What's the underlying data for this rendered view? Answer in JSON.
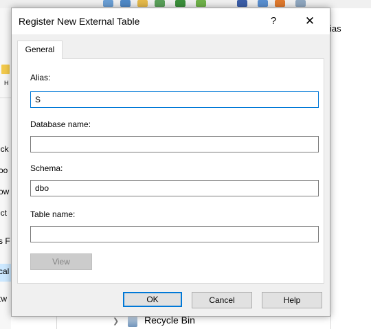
{
  "background": {
    "left_items": [
      "ick",
      "oo",
      "ow",
      "ict",
      "s F",
      "cal",
      "tw"
    ],
    "left_short": "H",
    "right_text": "ias",
    "tree_item": "Recycle Bin"
  },
  "dialog": {
    "title": "Register New External Table",
    "help_glyph": "?",
    "close_glyph": "✕",
    "tab_label": "General",
    "fields": {
      "alias": {
        "label": "Alias:",
        "value": "S"
      },
      "database": {
        "label": "Database name:",
        "value": ""
      },
      "schema": {
        "label": "Schema:",
        "value": "dbo"
      },
      "table": {
        "label": "Table name:",
        "value": ""
      }
    },
    "view_label": "View",
    "buttons": {
      "ok": "OK",
      "cancel": "Cancel",
      "help": "Help"
    }
  },
  "colors": {
    "accent": "#0078d7",
    "selection": "#cce8ff",
    "dialog_bg": "#f0f0f0"
  }
}
